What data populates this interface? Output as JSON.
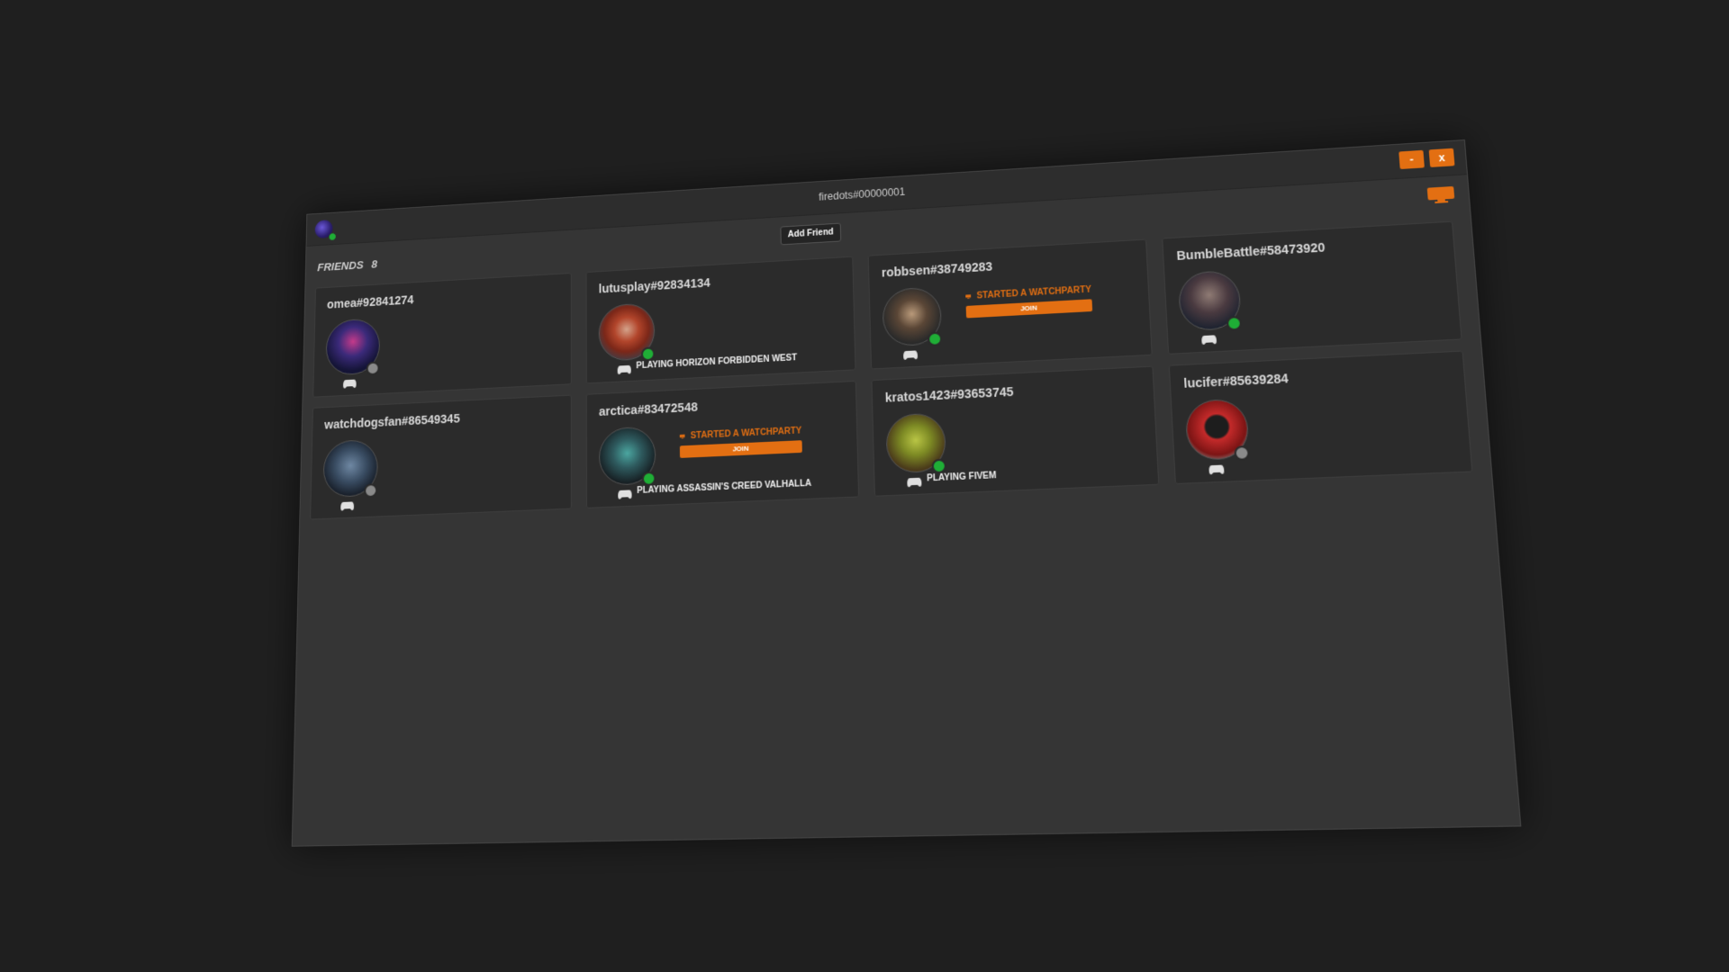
{
  "window": {
    "title": "firedots#00000001",
    "minimize_label": "-",
    "close_label": "x",
    "add_friend_label": "Add Friend",
    "watchparty_icon": "tv-icon"
  },
  "friends": {
    "label": "FRIENDS",
    "count": "8",
    "cards": [
      {
        "name": "omea#92841274",
        "status": "offline",
        "activity": "",
        "watchparty": null
      },
      {
        "name": "lutusplay#92834134",
        "status": "online",
        "activity": "PLAYING HORIZON FORBIDDEN WEST",
        "watchparty": null
      },
      {
        "name": "robbsen#38749283",
        "status": "online",
        "activity": "",
        "watchparty": {
          "label": "STARTED A WATCHPARTY",
          "join": "JOIN"
        }
      },
      {
        "name": "BumbleBattle#58473920",
        "status": "online",
        "activity": "",
        "watchparty": null
      },
      {
        "name": "watchdogsfan#86549345",
        "status": "offline",
        "activity": "",
        "watchparty": null
      },
      {
        "name": "arctica#83472548",
        "status": "online",
        "activity": "PLAYING ASSASSIN'S CREED VALHALLA",
        "watchparty": {
          "label": "STARTED A WATCHPARTY",
          "join": "JOIN"
        }
      },
      {
        "name": "kratos1423#93653745",
        "status": "online",
        "activity": "PLAYING FIVEM",
        "watchparty": null
      },
      {
        "name": "lucifer#85639284",
        "status": "offline",
        "activity": "",
        "watchparty": null
      }
    ]
  },
  "colors": {
    "accent": "#e36f12",
    "online": "#1fae36",
    "offline": "#8a8a8a",
    "background": "#353535",
    "card": "#2b2b2b"
  }
}
